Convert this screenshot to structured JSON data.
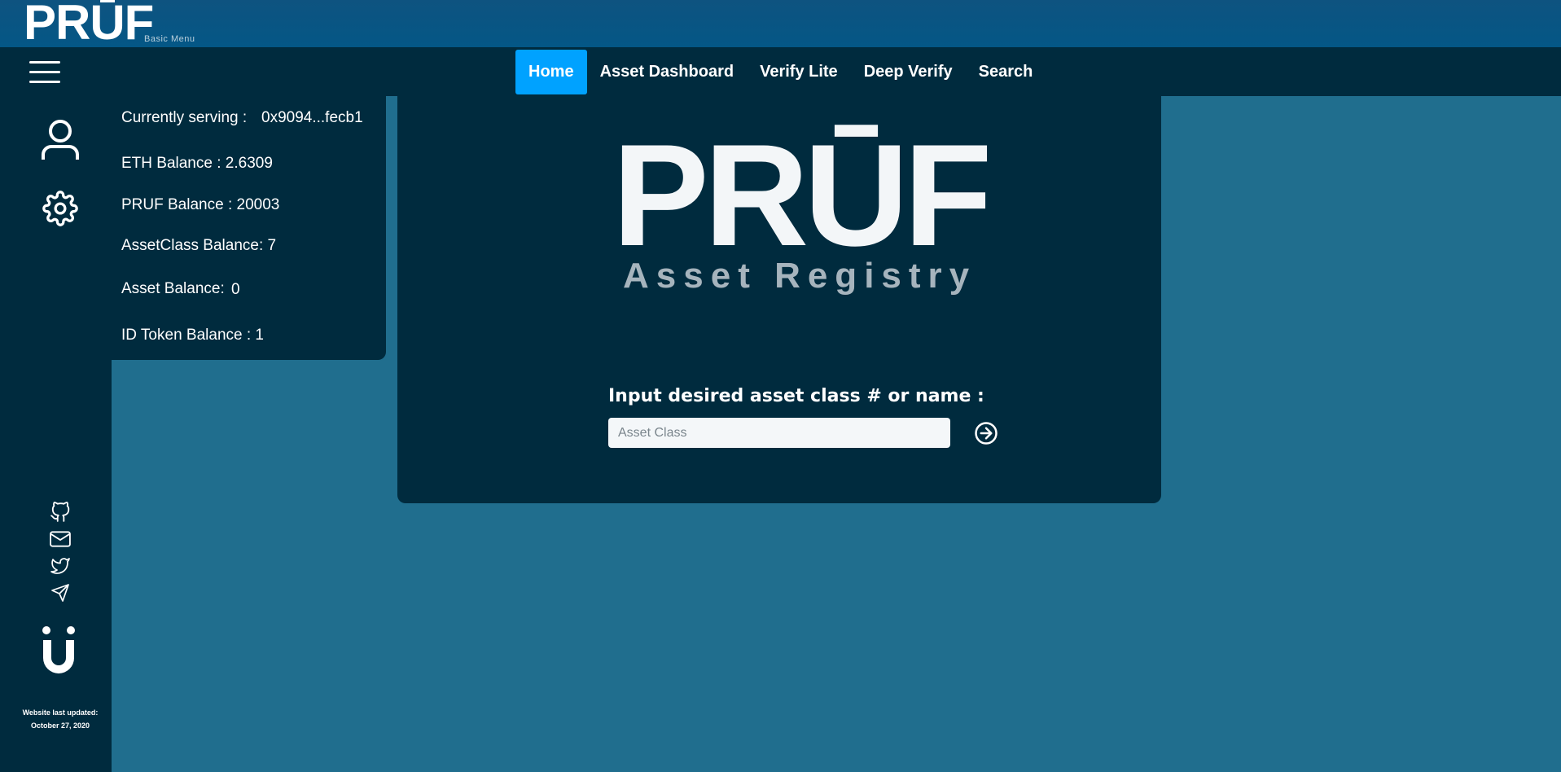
{
  "brand": {
    "logo_text": "PRŪF",
    "subtitle": "Basic Menu"
  },
  "nav": {
    "items": [
      {
        "label": "Home",
        "active": true
      },
      {
        "label": "Asset Dashboard",
        "active": false
      },
      {
        "label": "Verify Lite",
        "active": false
      },
      {
        "label": "Deep Verify",
        "active": false
      },
      {
        "label": "Search",
        "active": false
      }
    ]
  },
  "sidebar": {
    "icons": [
      "user-icon",
      "gear-icon"
    ],
    "social_icons": [
      "github-icon",
      "mail-icon",
      "twitter-icon",
      "telegram-icon"
    ],
    "footer_logo": "Ü",
    "footer_line1": "Website last updated:",
    "footer_line2": "October 27, 2020"
  },
  "balances": {
    "currently_serving_label": "Currently serving :",
    "currently_serving_value": "0x9094...fecb1",
    "eth": "ETH Balance : 2.6309",
    "pruf": "PRUF Balance : 20003",
    "asset_class": "AssetClass Balance: 7",
    "asset_label": "Asset Balance:",
    "asset_value": "0",
    "id_token": "ID Token Balance : 1"
  },
  "main": {
    "hero_title": "PRŪF",
    "hero_subtitle": "Asset Registry",
    "prompt": "Input desired asset class # or name :",
    "input_placeholder": "Asset Class",
    "input_value": "",
    "submit_icon": "arrow-right-circle-icon"
  },
  "colors": {
    "page_bg": "#206e8e",
    "panel_bg": "#002b3e",
    "nav_active": "#00a2ff"
  }
}
